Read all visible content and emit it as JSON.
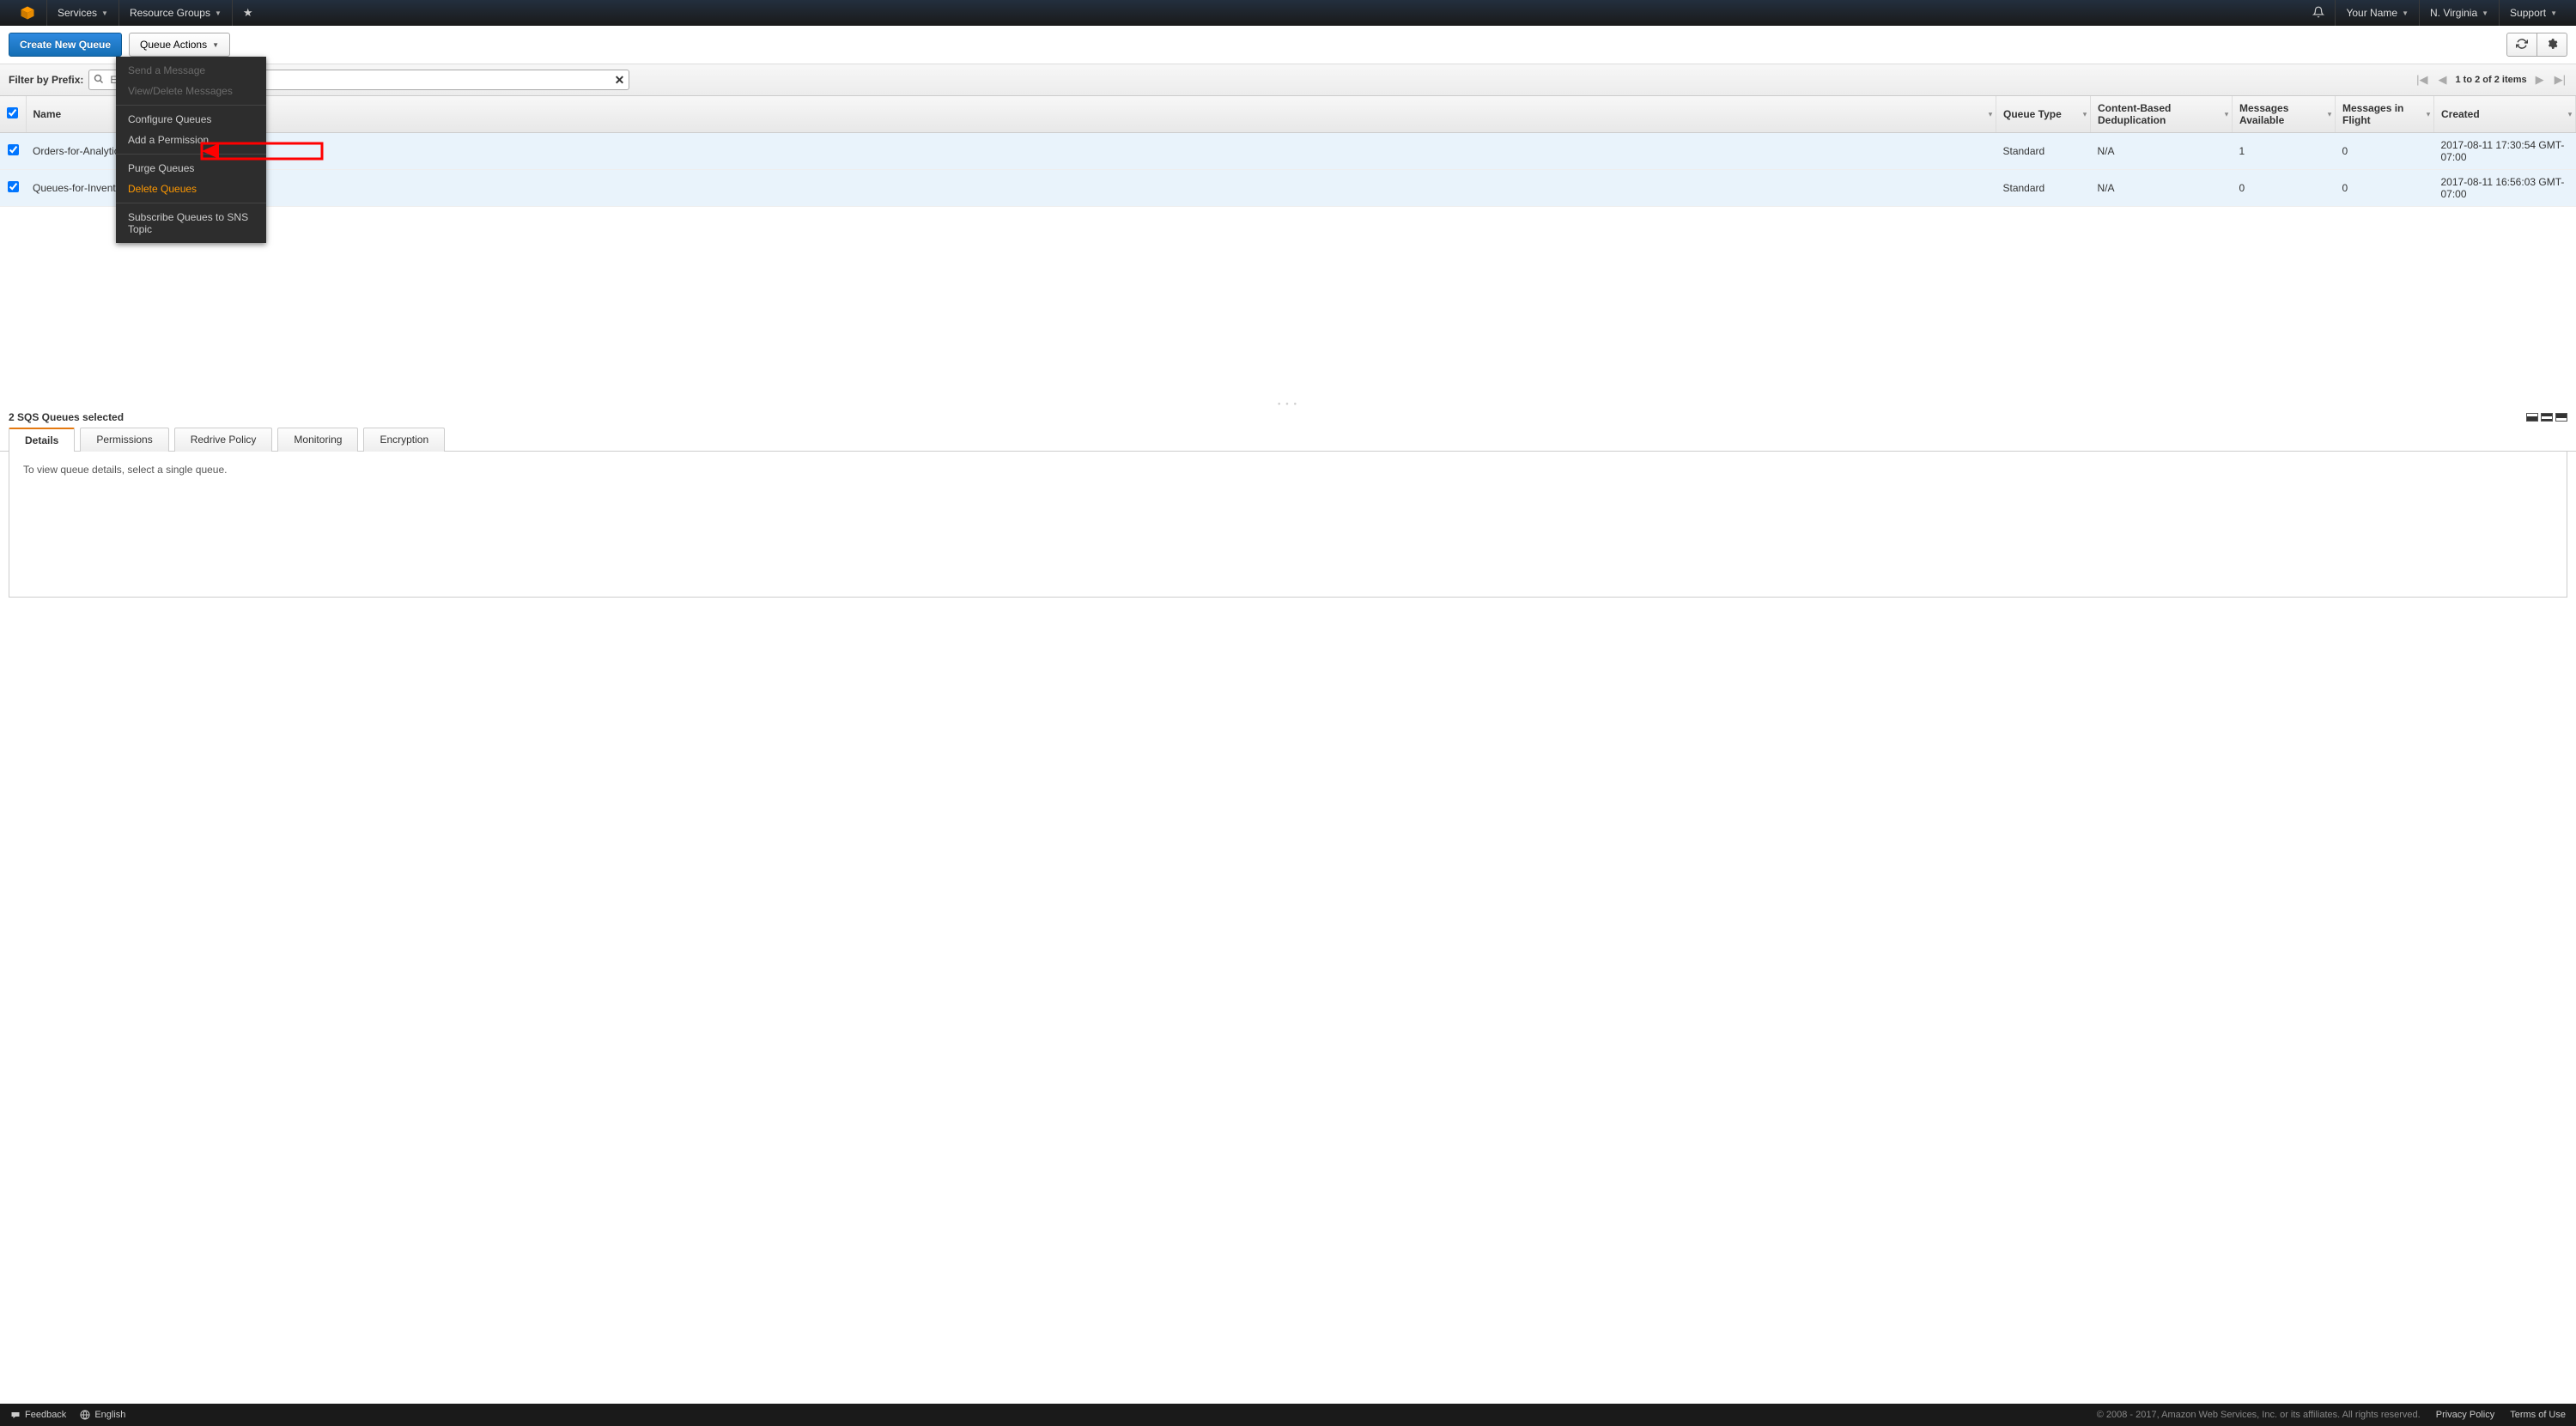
{
  "topnav": {
    "services": "Services",
    "resource_groups": "Resource Groups",
    "user": "Your Name",
    "region": "N. Virginia",
    "support": "Support"
  },
  "actions": {
    "create": "Create New Queue",
    "queue_actions": "Queue Actions"
  },
  "dropdown": {
    "send": "Send a Message",
    "view_delete_msgs": "View/Delete Messages",
    "configure": "Configure Queues",
    "add_perm": "Add a Permission",
    "purge": "Purge Queues",
    "delete": "Delete Queues",
    "subscribe": "Subscribe Queues to SNS Topic"
  },
  "filter": {
    "label": "Filter by Prefix:",
    "placeholder": "Enter Text",
    "value": ""
  },
  "pager": {
    "text": "1 to 2 of 2 items"
  },
  "columns": {
    "name": "Name",
    "queue_type": "Queue Type",
    "cbd": "Content-Based Deduplication",
    "msgs_avail": "Messages Available",
    "msgs_flight": "Messages in Flight",
    "created": "Created"
  },
  "rows": [
    {
      "name": "Orders-for-Analytics",
      "queue_type": "Standard",
      "cbd": "N/A",
      "avail": "1",
      "flight": "0",
      "created": "2017-08-11 17:30:54 GMT-07:00"
    },
    {
      "name": "Queues-for-Inventory",
      "queue_type": "Standard",
      "cbd": "N/A",
      "avail": "0",
      "flight": "0",
      "created": "2017-08-11 16:56:03 GMT-07:00"
    }
  ],
  "detail": {
    "selected_text": "2 SQS Queues selected",
    "tabs": {
      "details": "Details",
      "permissions": "Permissions",
      "redrive": "Redrive Policy",
      "monitoring": "Monitoring",
      "encryption": "Encryption"
    },
    "body": "To view queue details, select a single queue."
  },
  "footer": {
    "feedback": "Feedback",
    "language": "English",
    "copyright": "© 2008 - 2017, Amazon Web Services, Inc. or its affiliates. All rights reserved.",
    "privacy": "Privacy Policy",
    "terms": "Terms of Use"
  }
}
